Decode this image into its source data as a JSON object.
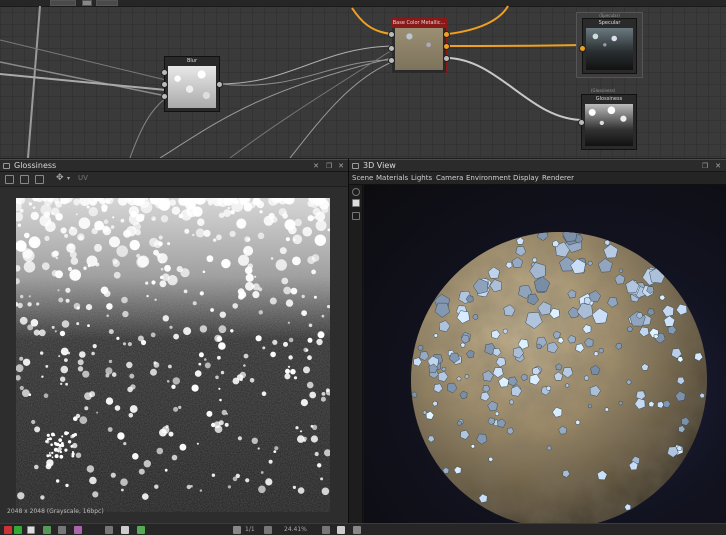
{
  "graph": {
    "nodes": {
      "blur": {
        "title": "Blur"
      },
      "base": {
        "title": "Base Color Metallic..."
      },
      "specular": {
        "title": "Specular",
        "badge": "(Specular)"
      },
      "glossiness": {
        "title": "Glossiness",
        "badge": "(Glossiness)"
      }
    },
    "wire_color_primary": "#f0a020",
    "wire_color_secondary": "#bbbbbb"
  },
  "gloss_panel": {
    "title": "Glossiness",
    "uv_label": "UV",
    "status": "2048 x 2048 (Grayscale, 16bpc)",
    "icons": [
      "image-icon",
      "layers-icon",
      "save-icon",
      "move-icon"
    ]
  },
  "view3d": {
    "title": "3D View",
    "menu": [
      "Scene",
      "Materials",
      "Lights",
      "Camera",
      "Environment",
      "Display",
      "Renderer"
    ]
  },
  "statusbar": {
    "page": "1/1",
    "zoom": "24.41%"
  },
  "colors": {
    "panel_bg": "#2d2d2d",
    "header_bg": "#2b2b2b",
    "node_selected": "#8a1a1a",
    "accent_orange": "#f0a020"
  }
}
